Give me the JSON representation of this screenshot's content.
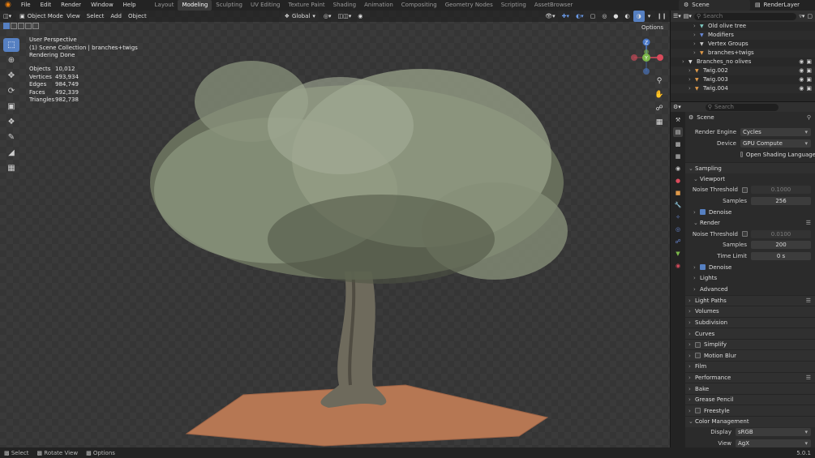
{
  "menu": {
    "items": [
      "File",
      "Edit",
      "Render",
      "Window",
      "Help"
    ],
    "workspaces": [
      "Layout",
      "Modeling",
      "Sculpting",
      "UV Editing",
      "Texture Paint",
      "Shading",
      "Animation",
      "Compositing",
      "Geometry Nodes",
      "Scripting",
      "AssetBrowser"
    ],
    "active_workspace": "Modeling",
    "scene": "Scene",
    "render_layer": "RenderLayer"
  },
  "viewport": {
    "mode": "Object Mode",
    "menus": [
      "View",
      "Select",
      "Add",
      "Object"
    ],
    "orientation": "Global",
    "options_label": "Options",
    "perspective": "User Perspective",
    "collection": "(1) Scene Collection | branches+twigs",
    "status": "Rendering Done",
    "stats": [
      {
        "label": "Objects",
        "value": "10,012"
      },
      {
        "label": "Vertices",
        "value": "493,934"
      },
      {
        "label": "Edges",
        "value": "984,749"
      },
      {
        "label": "Faces",
        "value": "492,339"
      },
      {
        "label": "Triangles",
        "value": "982,738"
      }
    ],
    "gizmo": {
      "x_color": "#d94b5c",
      "y_color": "#7cb84a",
      "z_color": "#4a78c8",
      "z_label": "Z",
      "y_label": "Y"
    }
  },
  "outliner": {
    "search_placeholder": "Search",
    "rows": [
      {
        "indent": 18,
        "label": "Old olive tree",
        "icon": "mesh-icon",
        "color": "#7ec8c0"
      },
      {
        "indent": 18,
        "label": "Modifiers",
        "icon": "wrench-icon",
        "color": "#6a8ad8"
      },
      {
        "indent": 18,
        "label": "Vertex Groups",
        "icon": "vertex-group-icon",
        "color": "#c7c7c7"
      },
      {
        "indent": 18,
        "label": "branches+twigs",
        "icon": "particles-icon",
        "color": "#e09a4a"
      },
      {
        "indent": 4,
        "label": "Branches_no olives",
        "icon": "collection-icon",
        "color": "#dcdcdc"
      },
      {
        "indent": 12,
        "label": "Twig.002",
        "icon": "object-icon",
        "color": "#e09a4a"
      },
      {
        "indent": 12,
        "label": "Twig.003",
        "icon": "object-icon",
        "color": "#e09a4a"
      },
      {
        "indent": 12,
        "label": "Twig.004",
        "icon": "object-icon",
        "color": "#e09a4a"
      }
    ]
  },
  "properties": {
    "search_placeholder": "Search",
    "context": "Scene",
    "render_engine": {
      "label": "Render Engine",
      "value": "Cycles"
    },
    "device": {
      "label": "Device",
      "value": "GPU Compute"
    },
    "open_shading_language": "Open Shading Language",
    "sampling": {
      "title": "Sampling",
      "viewport": {
        "title": "Viewport",
        "noise_threshold_label": "Noise Threshold",
        "noise_threshold": "0.1000",
        "samples_label": "Samples",
        "samples": "256",
        "denoise": "Denoise"
      },
      "render": {
        "title": "Render",
        "noise_threshold_label": "Noise Threshold",
        "noise_threshold": "0.0100",
        "samples_label": "Samples",
        "samples": "200",
        "time_limit_label": "Time Limit",
        "time_limit": "0 s",
        "denoise": "Denoise"
      },
      "lights": "Lights",
      "advanced": "Advanced"
    },
    "sections": [
      "Light Paths",
      "Volumes",
      "Subdivision",
      "Curves",
      "Simplify",
      "Motion Blur",
      "Film",
      "Performance",
      "Bake",
      "Grease Pencil",
      "Freestyle",
      "Color Management"
    ],
    "color_management": {
      "display_label": "Display",
      "display": "sRGB",
      "view_label": "View",
      "view": "AgX"
    }
  },
  "statusbar": {
    "select": "Select",
    "rotate": "Rotate View",
    "options": "Options",
    "version": "5.0.1"
  }
}
